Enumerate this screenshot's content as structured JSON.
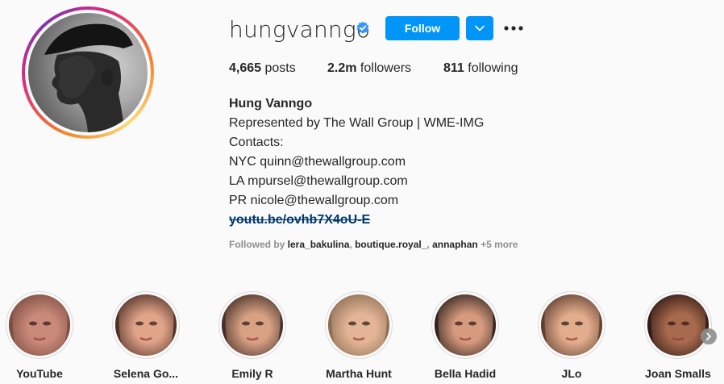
{
  "profile": {
    "username": "hungvanngo",
    "verified_icon": "verified-badge-icon",
    "follow_label": "Follow",
    "dropdown_icon": "chevron-down-icon",
    "more_icon": "more-options-icon",
    "colors": {
      "accent": "#0095f6",
      "text": "#262626",
      "muted": "#8e8e8e",
      "link": "#00376b"
    }
  },
  "stats": {
    "posts_count": "4,665",
    "posts_label": " posts",
    "followers_count": "2.2m",
    "followers_label": " followers",
    "following_count": "811",
    "following_label": " following"
  },
  "bio": {
    "name": "Hung Vanngo",
    "lines": [
      "Represented by The Wall Group | WME-IMG",
      "Contacts:",
      "NYC quinn@thewallgroup.com",
      "LA mpursel@thewallgroup.com",
      "PR nicole@thewallgroup.com"
    ],
    "link": "youtu.be/ovhb7X4oU-E"
  },
  "followed_by": {
    "prefix": "Followed by ",
    "accounts": [
      "lera_bakulina",
      "boutique.royal_",
      "annaphan"
    ],
    "separator": ", ",
    "more": " +5 more"
  },
  "highlights": [
    {
      "label": "YouTube",
      "tone": [
        "#c98a7a",
        "#7a4a3e"
      ]
    },
    {
      "label": "Selena Go...",
      "tone": [
        "#e0a489",
        "#4a2a22"
      ]
    },
    {
      "label": "Emily R",
      "tone": [
        "#d8a184",
        "#3e2a24"
      ]
    },
    {
      "label": "Martha Hunt",
      "tone": [
        "#e3b596",
        "#8a6b52"
      ]
    },
    {
      "label": "Bella Hadid",
      "tone": [
        "#d69a7e",
        "#2a1d1a"
      ]
    },
    {
      "label": "JLo",
      "tone": [
        "#e2ad8d",
        "#5a3a2c"
      ]
    },
    {
      "label": "Joan Smalls",
      "tone": [
        "#a86a4e",
        "#2a1712"
      ]
    }
  ],
  "next_icon": "chevron-right-icon"
}
